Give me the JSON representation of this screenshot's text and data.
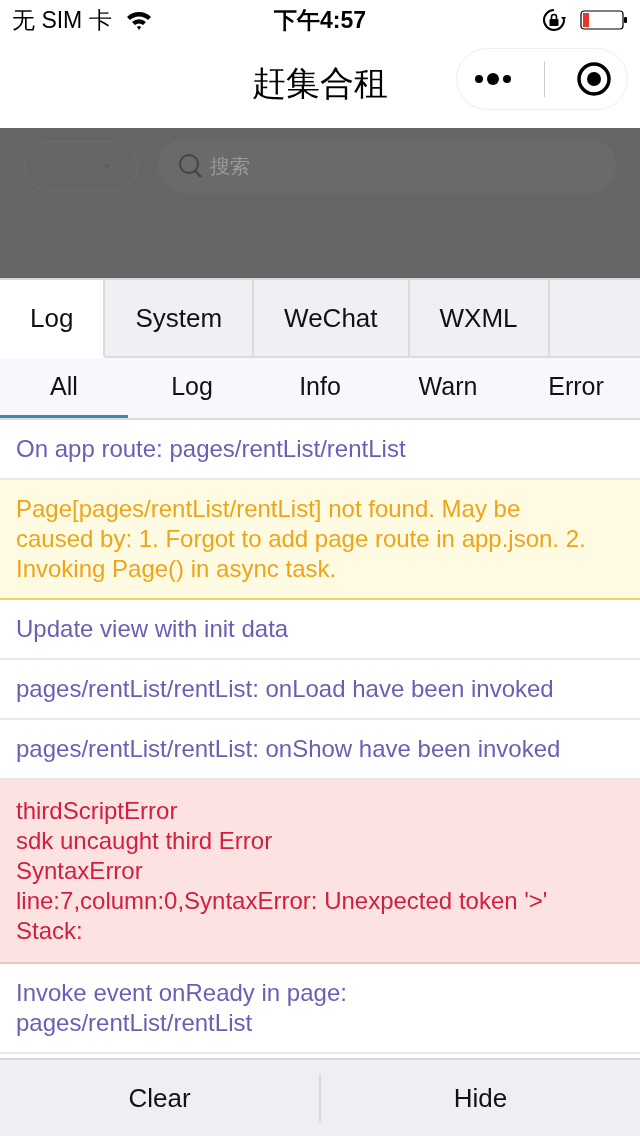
{
  "status_bar": {
    "carrier": "无 SIM 卡",
    "time": "下午4:57"
  },
  "nav_bar": {
    "title": "赶集合租"
  },
  "background_page": {
    "search": {
      "placeholder": "搜索"
    }
  },
  "tabs": [
    {
      "label": "Log",
      "selected": true
    },
    {
      "label": "System",
      "selected": false
    },
    {
      "label": "WeChat",
      "selected": false
    },
    {
      "label": "WXML",
      "selected": false
    }
  ],
  "filters": [
    {
      "label": "All",
      "selected": true
    },
    {
      "label": "Log",
      "selected": false
    },
    {
      "label": "Info",
      "selected": false
    },
    {
      "label": "Warn",
      "selected": false
    },
    {
      "label": "Error",
      "selected": false
    }
  ],
  "logs": [
    {
      "kind": "log",
      "text": "On app route: pages/rentList/rentList"
    },
    {
      "kind": "warn",
      "text": "Page[pages/rentList/rentList] not found. May be caused by: 1. Forgot to add page route in app.json. 2. Invoking Page() in async task."
    },
    {
      "kind": "log",
      "text": "Update view with init data"
    },
    {
      "kind": "log",
      "text": "pages/rentList/rentList: onLoad have been invoked"
    },
    {
      "kind": "log",
      "text": "pages/rentList/rentList: onShow have been invoked"
    },
    {
      "kind": "error",
      "text": "thirdScriptError\nsdk uncaught third Error\nSyntaxError\nline:7,column:0,SyntaxError: Unexpected token '>'\nStack:"
    },
    {
      "kind": "log",
      "text": "Invoke event onReady in page:\npages/rentList/rentList"
    }
  ],
  "buttons": [
    "Clear",
    "Hide"
  ]
}
